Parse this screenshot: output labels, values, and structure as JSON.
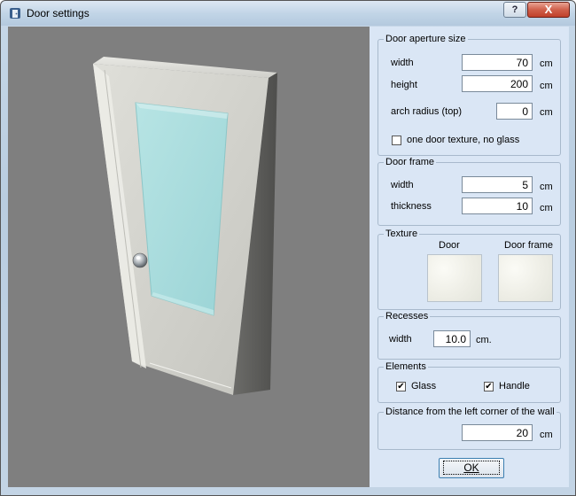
{
  "window": {
    "title": "Door settings",
    "app_icon": "door-settings-icon"
  },
  "titlebar": {
    "help_label": "?",
    "close_label": "X"
  },
  "aperture": {
    "legend": "Door aperture size",
    "width_label": "width",
    "width_value": "70",
    "width_unit": "cm",
    "height_label": "height",
    "height_value": "200",
    "height_unit": "cm",
    "arch_label": "arch radius (top)",
    "arch_value": "0",
    "arch_unit": "cm",
    "no_glass_label": "one door texture, no glass",
    "no_glass_checked": false
  },
  "frame": {
    "legend": "Door frame",
    "width_label": "width",
    "width_value": "5",
    "width_unit": "cm",
    "thickness_label": "thickness",
    "thickness_value": "10",
    "thickness_unit": "cm"
  },
  "texture": {
    "legend": "Texture",
    "door_label": "Door",
    "frame_label": "Door frame"
  },
  "recesses": {
    "legend": "Recesses",
    "width_label": "width",
    "width_value": "10.0",
    "width_unit": "cm."
  },
  "elements": {
    "legend": "Elements",
    "glass_label": "Glass",
    "glass_checked": true,
    "handle_label": "Handle",
    "handle_checked": true
  },
  "distance": {
    "legend": "Distance from the left corner of the wall",
    "value": "20",
    "unit": "cm"
  },
  "ok_label": "OK",
  "colors": {
    "viewport_bg": "#7f7f7f",
    "panel_bg": "#dae6f5",
    "glass": "#a5dbdc",
    "close_red": "#c7472f"
  }
}
